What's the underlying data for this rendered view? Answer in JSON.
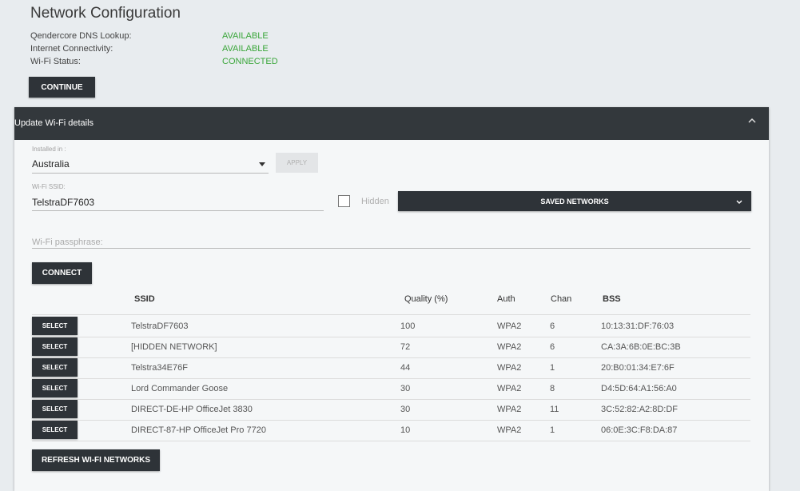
{
  "header": {
    "title": "Network Configuration",
    "status": [
      {
        "label": "Qendercore DNS Lookup:",
        "value": "AVAILABLE"
      },
      {
        "label": "Internet Connectivity:",
        "value": "AVAILABLE"
      },
      {
        "label": "Wi-Fi Status:",
        "value": "CONNECTED"
      }
    ],
    "continue_label": "CONTINUE",
    "status_color": "#3aa63a"
  },
  "panel": {
    "title": "Update Wi-Fi details",
    "installed_label": "Installed in :",
    "country": "Australia",
    "apply_label": "APPLY",
    "ssid_label": "Wi-Fi SSID:",
    "ssid_value": "TelstraDF7603",
    "hidden_label": "Hidden",
    "saved_networks_label": "SAVED NETWORKS",
    "passphrase_placeholder": "Wi-Fi passphrase:",
    "connect_label": "CONNECT",
    "refresh_label": "REFRESH WI-FI NETWORKS",
    "icons": {
      "collapse": "chevron-up-icon",
      "dropdown": "caret-down-icon"
    }
  },
  "table": {
    "columns": [
      "SSID",
      "Quality (%)",
      "Auth",
      "Chan",
      "BSS"
    ],
    "select_label": "SELECT",
    "rows": [
      {
        "ssid": "TelstraDF7603",
        "quality": "100",
        "auth": "WPA2",
        "chan": "6",
        "bss": "10:13:31:DF:76:03"
      },
      {
        "ssid": "[HIDDEN NETWORK]",
        "quality": "72",
        "auth": "WPA2",
        "chan": "6",
        "bss": "CA:3A:6B:0E:BC:3B"
      },
      {
        "ssid": "Telstra34E76F",
        "quality": "44",
        "auth": "WPA2",
        "chan": "1",
        "bss": "20:B0:01:34:E7:6F"
      },
      {
        "ssid": "Lord Commander Goose",
        "quality": "30",
        "auth": "WPA2",
        "chan": "8",
        "bss": "D4:5D:64:A1:56:A0"
      },
      {
        "ssid": "DIRECT-DE-HP OfficeJet 3830",
        "quality": "30",
        "auth": "WPA2",
        "chan": "11",
        "bss": "3C:52:82:A2:8D:DF"
      },
      {
        "ssid": "DIRECT-87-HP OfficeJet Pro 7720",
        "quality": "10",
        "auth": "WPA2",
        "chan": "1",
        "bss": "06:0E:3C:F8:DA:87"
      }
    ]
  }
}
